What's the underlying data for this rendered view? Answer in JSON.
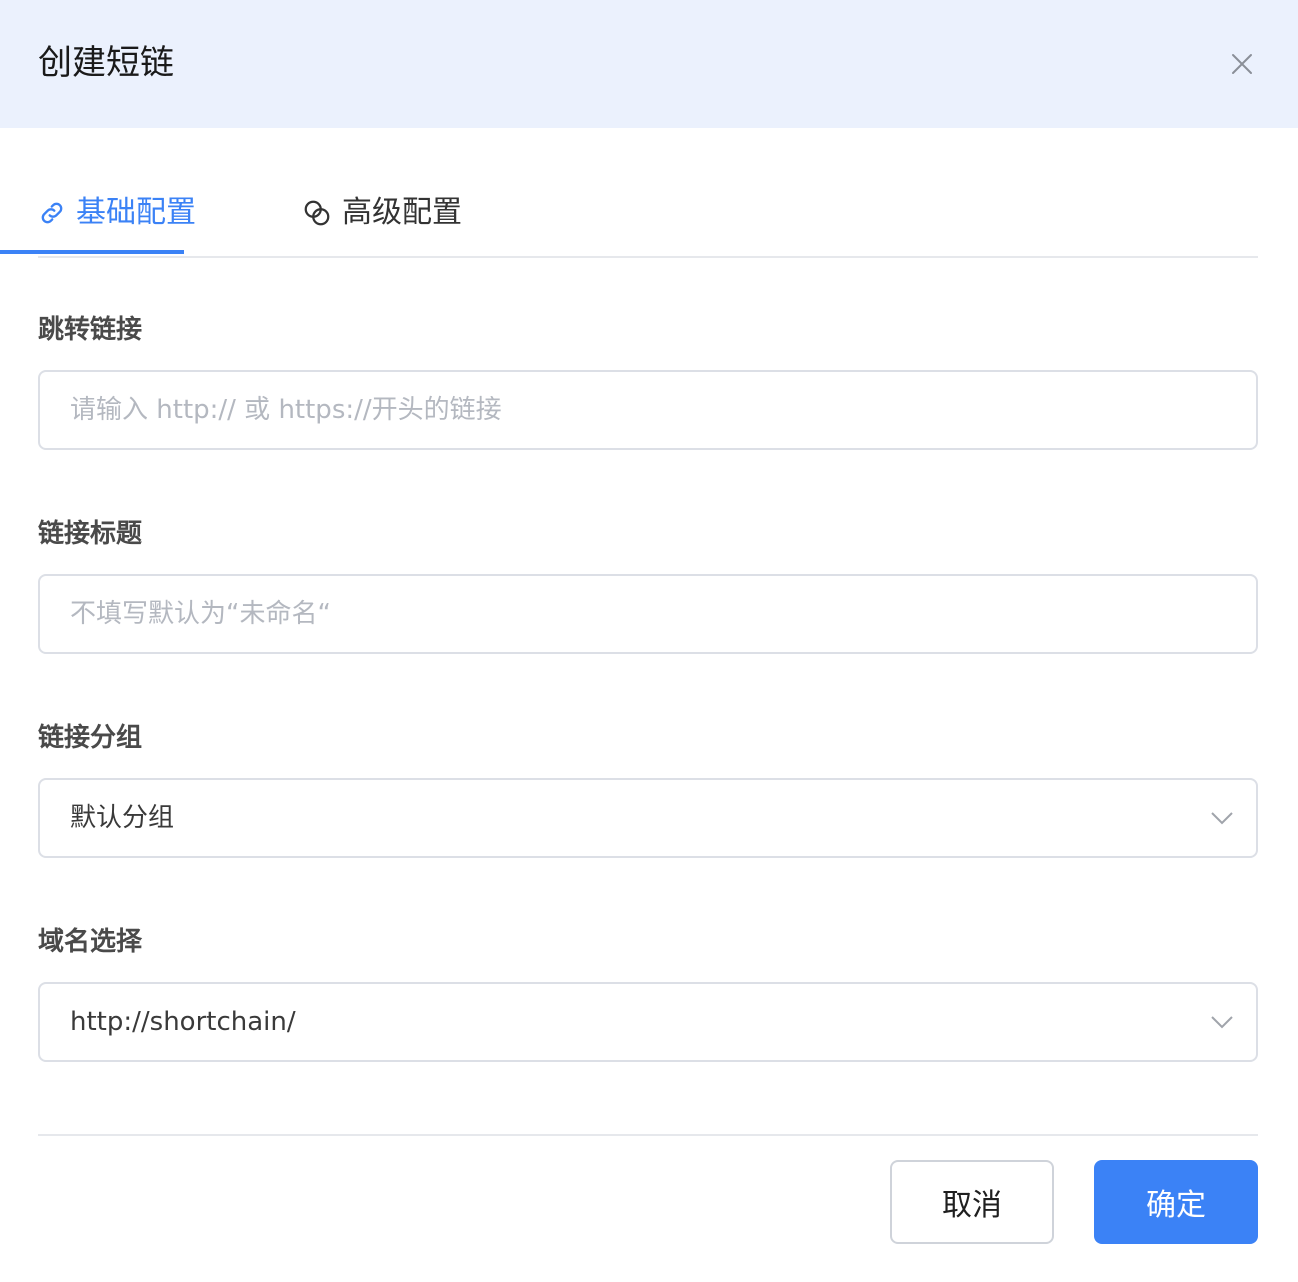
{
  "dialog": {
    "title": "创建短链",
    "close_icon": "close-icon"
  },
  "tabs": [
    {
      "label": "基础配置",
      "icon": "link-icon",
      "active": true
    },
    {
      "label": "高级配置",
      "icon": "advanced-link-icon",
      "active": false
    }
  ],
  "form": {
    "redirect_link": {
      "label": "跳转链接",
      "value": "",
      "placeholder": "请输入 http:// 或 https://开头的链接"
    },
    "link_title": {
      "label": "链接标题",
      "value": "",
      "placeholder": "不填写默认为“未命名“"
    },
    "link_group": {
      "label": "链接分组",
      "value": "默认分组"
    },
    "domain": {
      "label": "域名选择",
      "value": "http://shortchain/"
    }
  },
  "footer": {
    "cancel_label": "取消",
    "confirm_label": "确定"
  },
  "colors": {
    "accent": "#3b82f6",
    "header_bg": "#ebf1fd",
    "border": "#dcdfe6"
  }
}
